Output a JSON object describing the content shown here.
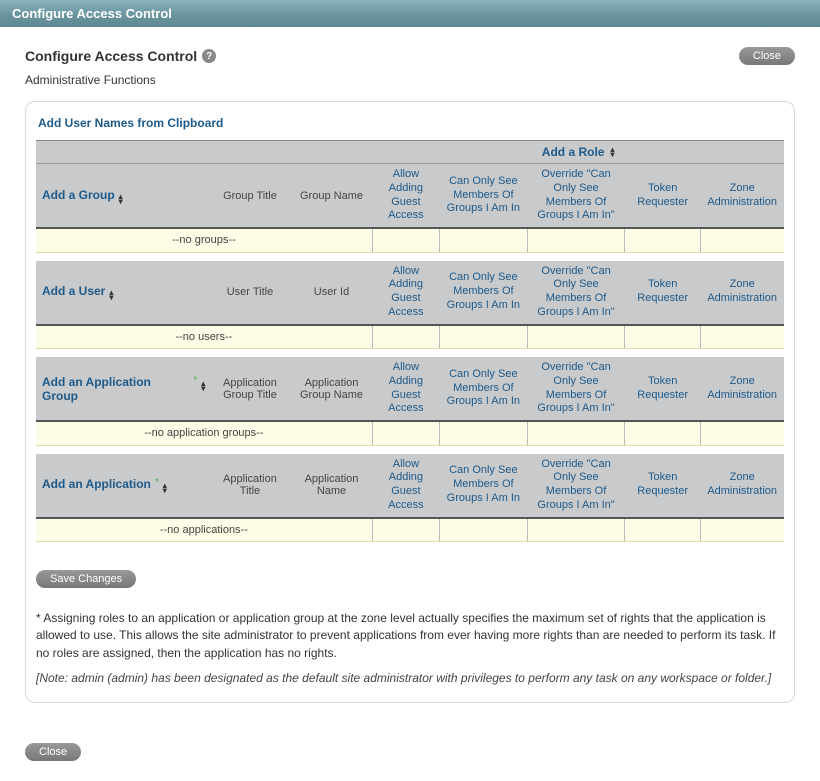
{
  "window": {
    "title": "Configure Access Control"
  },
  "page": {
    "title": "Configure Access Control",
    "subtitle": "Administrative Functions",
    "close_label": "Close"
  },
  "panel": {
    "clipboard_link": "Add User Names from Clipboard",
    "add_role_label": "Add a Role",
    "role_columns": [
      "Allow Adding Guest Access",
      "Can Only See Members Of Groups I Am In",
      "Override \"Can Only See Members Of Groups I Am In\"",
      "Token Requester",
      "Zone Administration"
    ],
    "sections": [
      {
        "add_label": "Add a Group",
        "show_asterisk": false,
        "col1": "Group Title",
        "col2": "Group Name",
        "empty_text": "--no groups--"
      },
      {
        "add_label": "Add a User",
        "show_asterisk": false,
        "col1": "User Title",
        "col2": "User Id",
        "empty_text": "--no users--"
      },
      {
        "add_label": "Add an Application Group",
        "show_asterisk": true,
        "col1": "Application Group Title",
        "col2": "Application Group Name",
        "empty_text": "--no application groups--"
      },
      {
        "add_label": "Add an Application",
        "show_asterisk": true,
        "col1": "Application Title",
        "col2": "Application Name",
        "empty_text": "--no applications--"
      }
    ]
  },
  "buttons": {
    "save_changes": "Save Changes",
    "close": "Close"
  },
  "notes": {
    "asterisk_note": "* Assigning roles to an application or application group at the zone level actually specifies the maximum set of rights that the application is allowed to use. This allows the site administrator to prevent applications from ever having more rights than are needed to perform its task. If no roles are assigned, then the application has no rights.",
    "admin_note": "[Note: admin (admin) has been designated as the default site administrator with privileges to perform any task on any workspace or folder.]"
  }
}
